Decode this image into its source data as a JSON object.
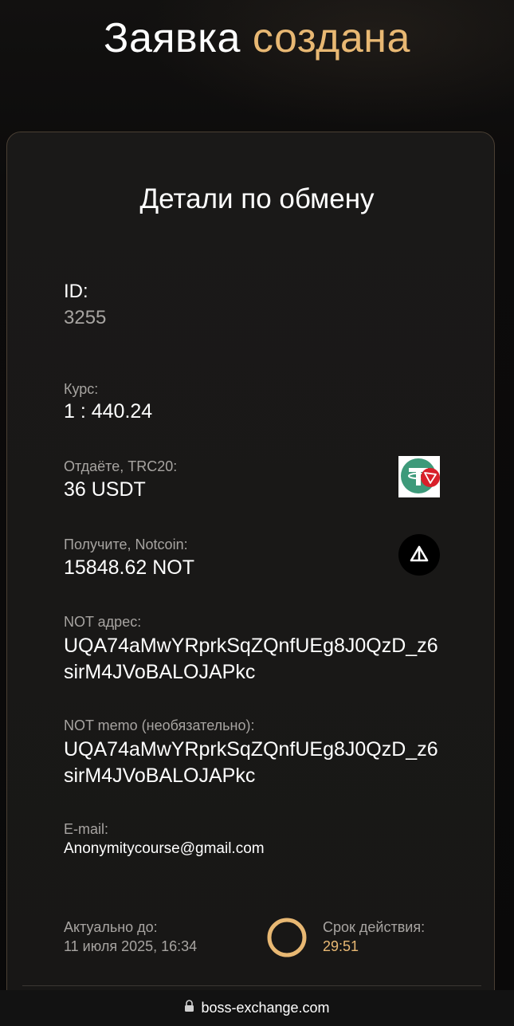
{
  "header": {
    "title_part1": "Заявка",
    "title_part2": "создана",
    "accent_color": "#e8b873"
  },
  "card": {
    "title": "Детали по обмену",
    "id_label": "ID:",
    "id_value": "3255",
    "rate_label": "Курс:",
    "rate_value": "1 : 440.24",
    "give_label": "Отдаёте, TRC20:",
    "give_value": "36 USDT",
    "give_icon": "usdt-trc20-icon",
    "receive_label": "Получите, Notcoin:",
    "receive_value": "15848.62 NOT",
    "receive_icon": "notcoin-icon",
    "address_label": "NOT адрес:",
    "address_value": "UQA74aMwYRprkSqZQnfUEg8J0QzD_z6sirM4JVoBALOJAPkc",
    "memo_label": "NOT memo (необязательно):",
    "memo_value": "UQA74aMwYRprkSqZQnfUEg8J0QzD_z6sirM4JVoBALOJAPkc",
    "email_label": "E-mail:",
    "email_value": "Anonymitycourse@gmail.com",
    "valid_until_label": "Актуально до:",
    "valid_until_value": "11 июля 2025, 16:34",
    "expiry_label": "Срок действия:",
    "expiry_value": "29:51"
  },
  "browser": {
    "url": "boss-exchange.com",
    "lock_icon": "lock-icon"
  }
}
